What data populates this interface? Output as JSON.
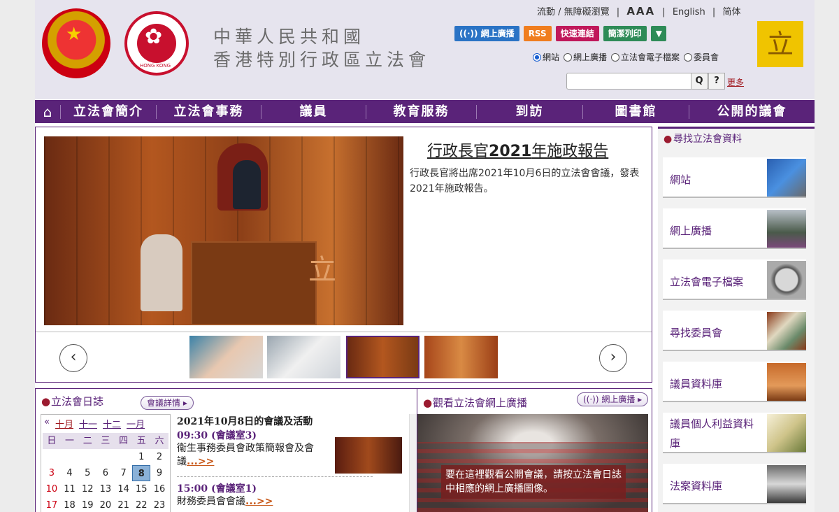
{
  "header": {
    "title_line1": "中華人民共和國",
    "title_line2": "香港特別行政區立法會",
    "toplinks": {
      "mobile": "流動 / 無障礙瀏覽",
      "sep1": "|",
      "text_size": "AAA",
      "sep2": "|",
      "english": "English",
      "sep3": "|",
      "simplified": "简体"
    },
    "buttons": {
      "webcast": "((·)) 網上廣播",
      "rss": "RSS",
      "quicklinks": "快速連結",
      "print": "簡潔列印",
      "dropdown": "▼"
    },
    "search_scopes": [
      "網站",
      "網上廣播",
      "立法會電子檔案",
      "委員會"
    ],
    "selected_scope": "網站",
    "search_placeholder": "",
    "search_button": "Q",
    "help_button": "?",
    "more_link": "更多",
    "logo_glyph": "立"
  },
  "nav": {
    "home_icon": "⌂",
    "items": [
      "立法會簡介",
      "立法會事務",
      "議員",
      "教育服務",
      "到訪",
      "圖書館",
      "公開的議會"
    ]
  },
  "feature": {
    "title_pre": "行政長官",
    "title_year": "2021",
    "title_post": "年施政報告",
    "description": "行政長官將出席2021年10月6日的立法會會議，發表2021年施政報告。",
    "prev": "‹",
    "next": "›",
    "hero_emblem": "立"
  },
  "sidebar": {
    "heading": "尋找立法會資料",
    "items": [
      "網站",
      "網上廣播",
      "立法會電子檔案",
      "尋找委員會",
      "議員資料庫",
      "議員個人利益資料庫",
      "法案資料庫"
    ]
  },
  "diary": {
    "heading": "立法會日誌",
    "details_button": "會議詳情 ▸",
    "months": [
      "«",
      "十月",
      "十一",
      "十二",
      "一月"
    ],
    "weekdays": [
      "日",
      "一",
      "二",
      "三",
      "四",
      "五",
      "六"
    ],
    "weeks": [
      [
        "",
        "",
        "",
        "",
        "",
        "1",
        "2"
      ],
      [
        "3",
        "4",
        "5",
        "6",
        "7",
        "8",
        "9"
      ],
      [
        "10",
        "11",
        "12",
        "13",
        "14",
        "15",
        "16"
      ],
      [
        "17",
        "18",
        "19",
        "20",
        "21",
        "22",
        "23"
      ]
    ],
    "today": "8",
    "event_heading": "2021年10月8日的會議及活動",
    "events": [
      {
        "time": "09:30 (會議室3)",
        "desc": "衞生事務委員會政策簡報會及會議",
        "more": "...>>"
      },
      {
        "time": "15:00 (會議室1)",
        "desc": "財務委員會會議",
        "more": "...>>"
      }
    ]
  },
  "webcast": {
    "heading": "觀看立法會網上廣播",
    "button": "((·)) 網上廣播 ▸",
    "note": "要在這裡觀看公開會議，請按立法會日誌中相應的網上廣播圖像。"
  },
  "colors": {
    "primary": "#5a2379",
    "accent": "#a0181e",
    "header_bg": "#e6e4ee"
  }
}
